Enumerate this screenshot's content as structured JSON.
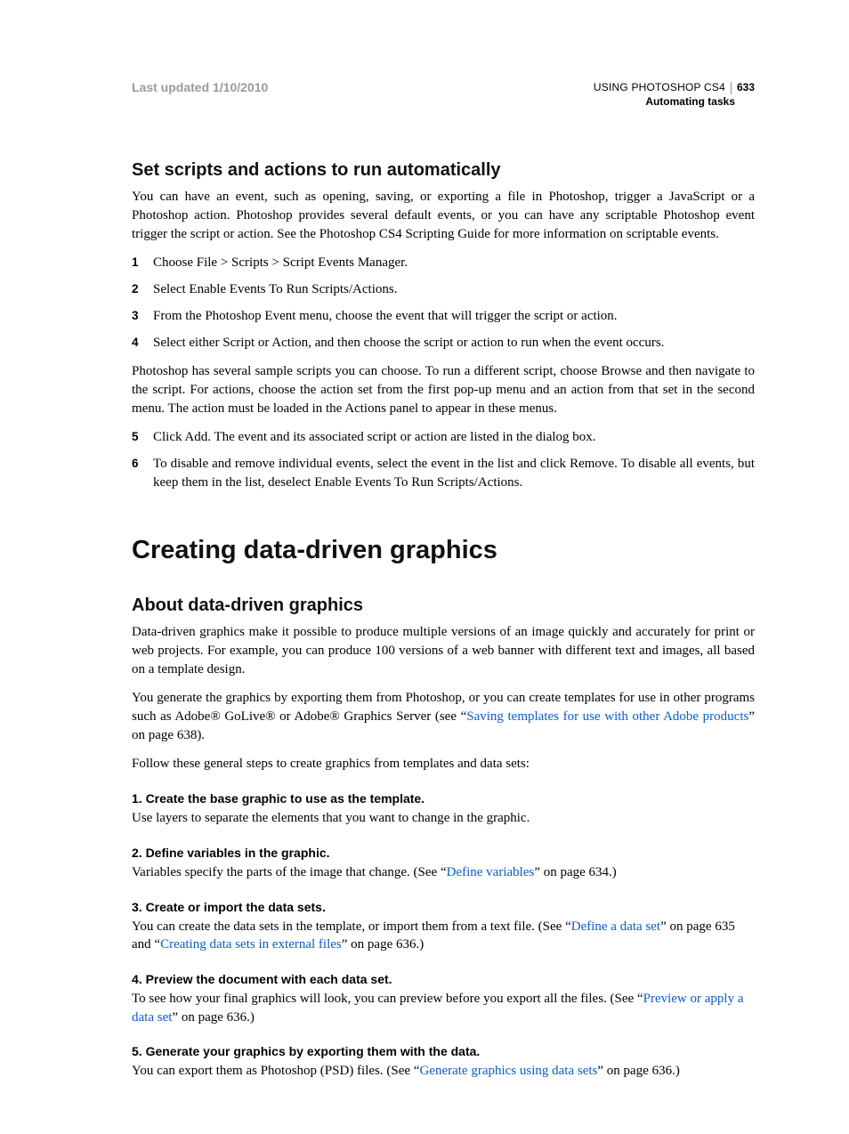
{
  "header": {
    "last_updated": "Last updated 1/10/2010",
    "book_title": "USING PHOTOSHOP CS4",
    "page_number": "633",
    "chapter": "Automating tasks"
  },
  "section1": {
    "heading": "Set scripts and actions to run automatically",
    "intro": "You can have an event, such as opening, saving, or exporting a file in Photoshop, trigger a JavaScript or a Photoshop action. Photoshop provides several default events, or you can have any scriptable Photoshop event trigger the script or action. See the Photoshop CS4 Scripting Guide for more information on scriptable events.",
    "steps_a": [
      "Choose File > Scripts > Script Events Manager.",
      "Select Enable Events To Run Scripts/Actions.",
      "From the Photoshop Event menu, choose the event that will trigger the script or action.",
      "Select either Script or Action, and then choose the script or action to run when the event occurs."
    ],
    "mid_para": "Photoshop has several sample scripts you can choose. To run a different script, choose Browse and then navigate to the script. For actions, choose the action set from the first pop-up menu and an action from that set in the second menu. The action must be loaded in the Actions panel to appear in these menus.",
    "steps_b": [
      "Click Add. The event and its associated script or action are listed in the dialog box.",
      "To disable and remove individual events, select the event in the list and click Remove. To disable all events, but keep them in the list, deselect Enable Events To Run Scripts/Actions."
    ]
  },
  "major_heading": "Creating data-driven graphics",
  "section2": {
    "heading": "About data-driven graphics",
    "p1": "Data-driven graphics make it possible to produce multiple versions of an image quickly and accurately for print or web projects. For example, you can produce 100 versions of a web banner with different text and images, all based on a template design.",
    "p2_pre": "You generate the graphics by exporting them from Photoshop, or you can create templates for use in other programs such as Adobe® GoLive® or Adobe® Graphics Server (see “",
    "p2_link": "Saving templates for use with other Adobe products",
    "p2_post": "” on page 638).",
    "p3": "Follow these general steps to create graphics from templates and data sets:",
    "substeps": [
      {
        "head": "1.   Create the base graphic to use as the template.",
        "pre": "Use layers to separate the elements that you want to change in the graphic.",
        "links": []
      },
      {
        "head": "2.   Define variables in the graphic.",
        "pre": "Variables specify the parts of the image that change. (See “",
        "links": [
          {
            "text": "Define variables",
            "post": "” on page 634.)"
          }
        ]
      },
      {
        "head": "3.   Create or import the data sets.",
        "pre": "You can create the data sets in the template, or import them from a text file. (See “",
        "links": [
          {
            "text": "Define a data set",
            "post": "” on page 635 and “"
          },
          {
            "text": "Creating data sets in external files",
            "post": "” on page 636.)"
          }
        ]
      },
      {
        "head": "4.   Preview the document with each data set.",
        "pre": "To see how your final graphics will look, you can preview before you export all the files. (See “",
        "links": [
          {
            "text": "Preview or apply a data set",
            "post": "” on page 636.)"
          }
        ]
      },
      {
        "head": "5.   Generate your graphics by exporting them with the data.",
        "pre": "You can export them as Photoshop (PSD) files. (See “",
        "links": [
          {
            "text": "Generate graphics using data sets",
            "post": "” on page 636.)"
          }
        ]
      }
    ]
  }
}
